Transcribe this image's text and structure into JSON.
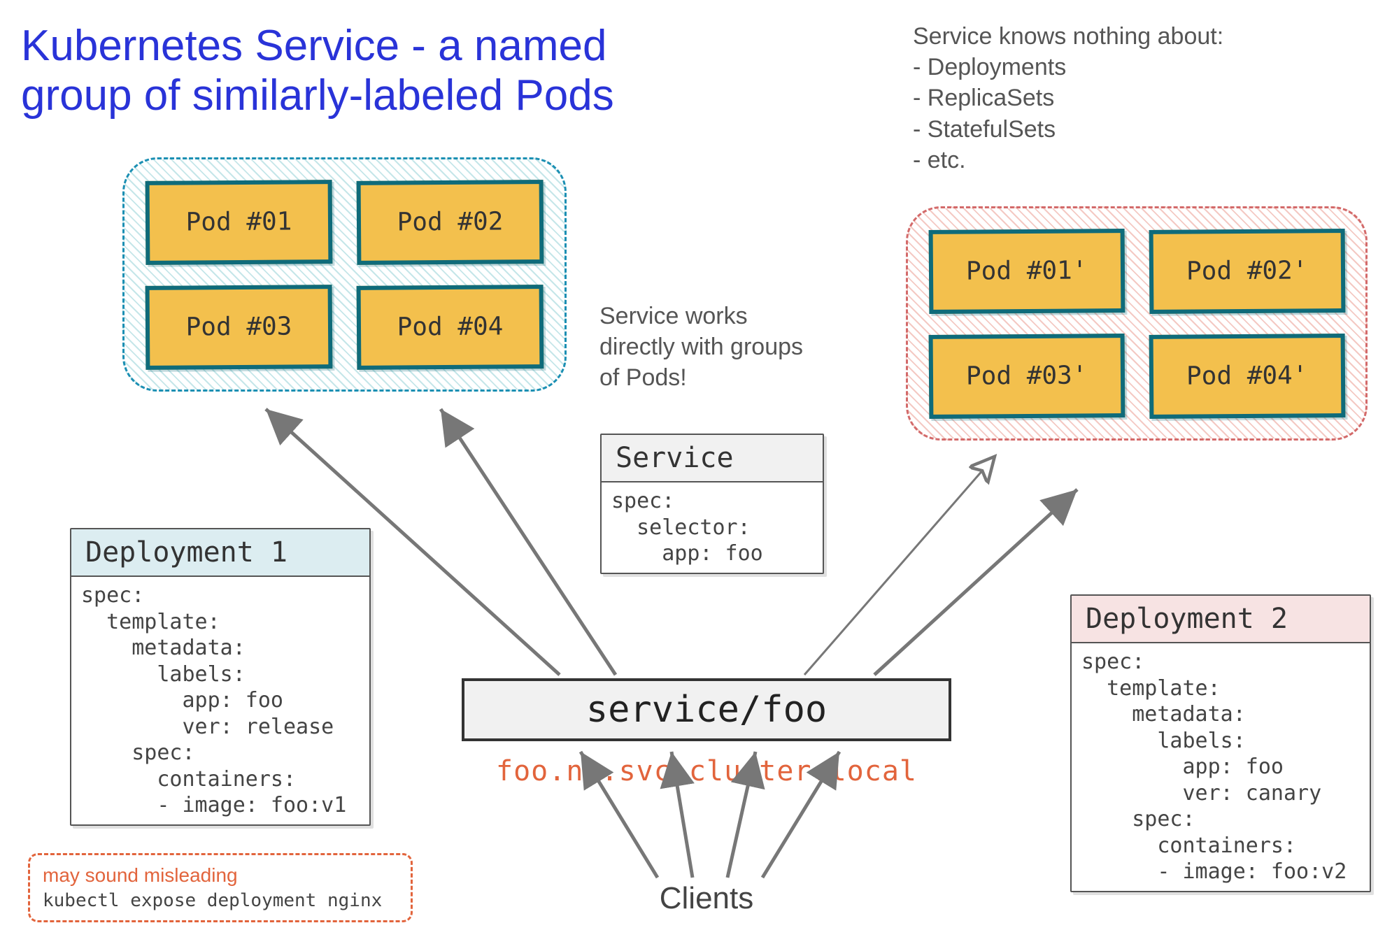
{
  "title": "Kubernetes Service - a named group of similarly-labeled Pods",
  "note_right": "Service knows nothing about:\n- Deployments\n- ReplicaSets\n- StatefulSets\n- etc.",
  "note_center": "Service works directly with groups of Pods!",
  "pod_group_blue": {
    "pods": [
      "Pod #01",
      "Pod #02",
      "Pod #03",
      "Pod #04"
    ]
  },
  "pod_group_red": {
    "pods": [
      "Pod #01'",
      "Pod #02'",
      "Pod #03'",
      "Pod #04'"
    ]
  },
  "deployment1": {
    "title": "Deployment 1",
    "spec": "spec:\n  template:\n    metadata:\n      labels:\n        app: foo\n        ver: release\n    spec:\n      containers:\n      - image: foo:v1"
  },
  "deployment2": {
    "title": "Deployment 2",
    "spec": "spec:\n  template:\n    metadata:\n      labels:\n        app: foo\n        ver: canary\n    spec:\n      containers:\n      - image: foo:v2"
  },
  "service_card": {
    "title": "Service",
    "spec": "spec:\n  selector:\n    app: foo"
  },
  "service_box": "service/foo",
  "dns_name": "foo.ns.svc.cluster.local",
  "clients_label": "Clients",
  "footnote": {
    "warn": "may sound misleading",
    "cmd": "kubectl expose deployment nginx"
  }
}
